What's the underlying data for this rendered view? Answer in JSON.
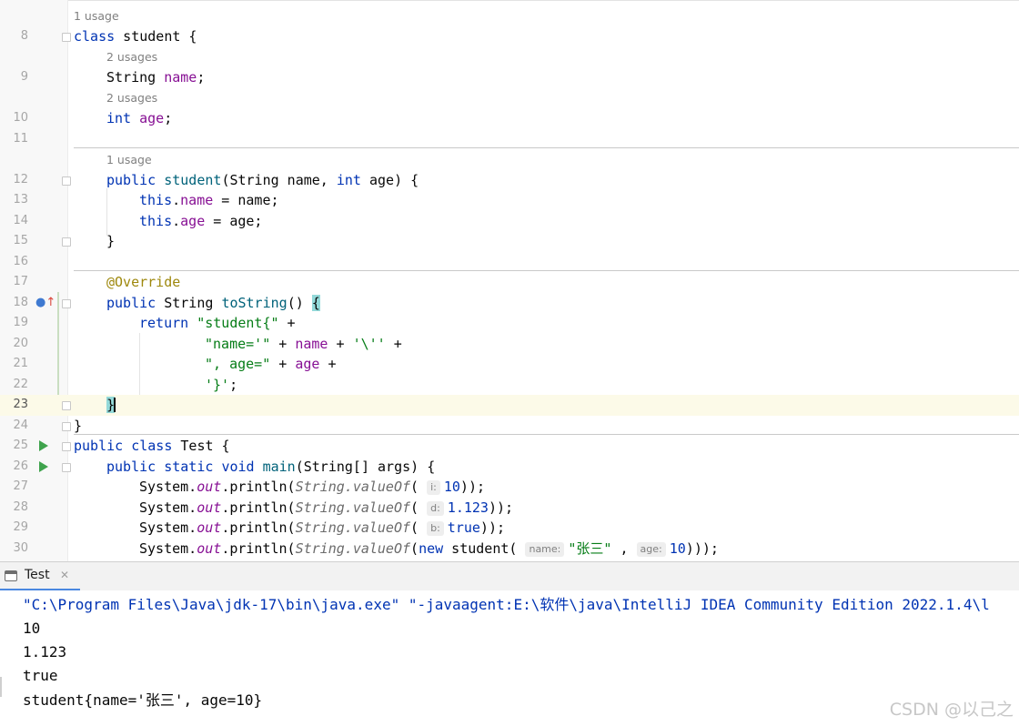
{
  "editor": {
    "usages": {
      "one": "1 usage",
      "two": "2 usages"
    },
    "lines": {
      "l8": "8",
      "l9": "9",
      "l10": "10",
      "l11": "11",
      "l12": "12",
      "l13": "13",
      "l14": "14",
      "l15": "15",
      "l16": "16",
      "l17": "17",
      "l18": "18",
      "l19": "19",
      "l20": "20",
      "l21": "21",
      "l22": "22",
      "l23": "23",
      "l24": "24",
      "l25": "25",
      "l26": "26",
      "l27": "27",
      "l28": "28",
      "l29": "29",
      "l30": "30"
    },
    "code": {
      "class_kw": "class",
      "class_name": " student {",
      "string_type": "String ",
      "name_field": "name",
      "semicolon": ";",
      "int_kw": "int",
      "age_field": "age",
      "public_kw": "public",
      "ctor_name": "student",
      "ctor_params_a": "(String name, ",
      "ctor_params_b": " age) {",
      "this_kw": "this",
      "dot": ".",
      "assign_name": " = name;",
      "assign_age": " = age;",
      "close_brace": "}",
      "override": "@Override",
      "tostring_ret": " String ",
      "tostring_name": "toString",
      "tostring_paren": "() ",
      "open_brace": "{",
      "return_kw": "return",
      "str_student": "\"student{\"",
      "plus": " +",
      "str_name_eq": "\"name='\"",
      "plus_mid": " + ",
      "char_quote": "'\\''",
      "str_age_eq": "\", age=\"",
      "char_close": "'}'",
      "public_class": "public class",
      "test_name": " Test {",
      "static_kw": "static",
      "void_kw": "void",
      "main_name": "main",
      "main_params": "(String[] args) {",
      "system": "System.",
      "out": "out",
      "println": ".println(",
      "string_cls": "String.",
      "valueof": "valueOf",
      "paren_open": "(",
      "hint_i": "i:",
      "val_10": "10",
      "close_2": "));",
      "hint_d": "d:",
      "val_1123": "1.123",
      "hint_b": "b:",
      "val_true": "true",
      "new_kw": "new",
      "student_call": " student(",
      "hint_name": "name:",
      "str_zhangsan": "\"张三\"",
      "comma": " ,",
      "hint_age": "age:",
      "close_3": ")));"
    }
  },
  "run_panel": {
    "tab_label": "Test",
    "tab_close": "✕",
    "output": [
      "\"C:\\Program Files\\Java\\jdk-17\\bin\\java.exe\" \"-javaagent:E:\\软件\\java\\IntelliJ IDEA Community Edition 2022.1.4\\l",
      "10",
      "1.123",
      "true",
      "student{name='张三', age=10}"
    ]
  },
  "watermark": "CSDN @以己之",
  "icons": [
    "run-gutter-icon",
    "override-gutter-icon",
    "fold-icon",
    "console-tab-icon",
    "close-icon"
  ]
}
